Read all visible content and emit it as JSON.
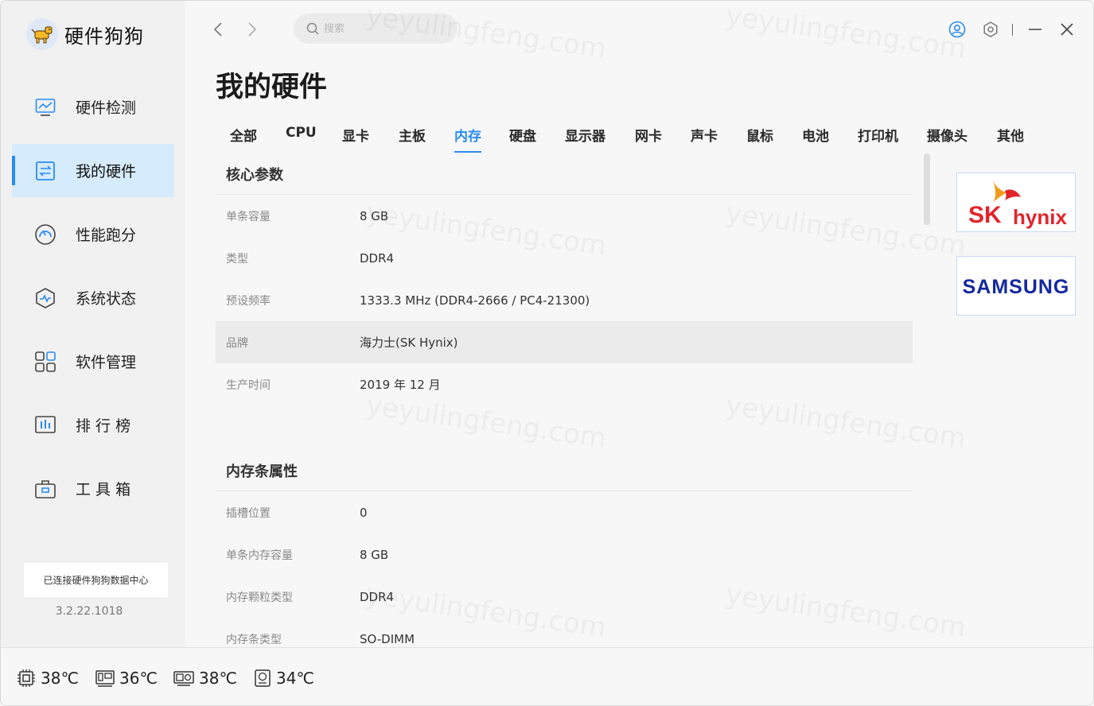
{
  "app": {
    "name": "硬件狗狗",
    "version": "3.2.22.1018",
    "connection_status": "已连接硬件狗狗数据中心"
  },
  "sidebar": {
    "items": [
      {
        "label": "硬件检测",
        "icon": "monitor-chart-icon",
        "active": false
      },
      {
        "label": "我的硬件",
        "icon": "hardware-transfer-icon",
        "active": true
      },
      {
        "label": "性能跑分",
        "icon": "speedometer-icon",
        "active": false
      },
      {
        "label": "系统状态",
        "icon": "system-status-icon",
        "active": false
      },
      {
        "label": "软件管理",
        "icon": "apps-grid-icon",
        "active": false
      },
      {
        "label": "排 行 榜",
        "icon": "ranking-chart-icon",
        "active": false
      },
      {
        "label": "工 具 箱",
        "icon": "toolbox-icon",
        "active": false
      }
    ]
  },
  "header": {
    "search_placeholder": "搜索",
    "page_title": "我的硬件"
  },
  "tabs": [
    "全部",
    "CPU",
    "显卡",
    "主板",
    "内存",
    "硬盘",
    "显示器",
    "网卡",
    "声卡",
    "鼠标",
    "电池",
    "打印机",
    "摄像头",
    "其他"
  ],
  "active_tab": "内存",
  "sections": [
    {
      "title": "核心参数",
      "rows": [
        {
          "key": "单条容量",
          "value": "8 GB"
        },
        {
          "key": "类型",
          "value": "DDR4"
        },
        {
          "key": "预设频率",
          "value": "1333.3 MHz (DDR4-2666 / PC4-21300)"
        },
        {
          "key": "品牌",
          "value": "海力士(SK Hynix)"
        },
        {
          "key": "生产时间",
          "value": "2019 年 12 月"
        }
      ]
    },
    {
      "title": "内存条属性",
      "rows": [
        {
          "key": "插槽位置",
          "value": "0"
        },
        {
          "key": "单条内存容量",
          "value": "8 GB"
        },
        {
          "key": "内存颗粒类型",
          "value": "DDR4"
        },
        {
          "key": "内存条类型",
          "value": "SO-DIMM"
        }
      ]
    }
  ],
  "brand_logos": [
    {
      "name": "SK hynix",
      "sk": "SK",
      "hynix": "hynix"
    },
    {
      "name": "SAMSUNG",
      "text": "SAMSUNG"
    }
  ],
  "temperatures": [
    {
      "label": "cpu",
      "icon": "cpu-chip-icon",
      "value": "38℃"
    },
    {
      "label": "motherboard",
      "icon": "motherboard-icon",
      "value": "36℃"
    },
    {
      "label": "gpu",
      "icon": "graphics-card-icon",
      "value": "38℃"
    },
    {
      "label": "disk",
      "icon": "hard-disk-icon",
      "value": "34℃"
    }
  ],
  "watermark": "yeyulingfeng.com",
  "colors": {
    "accent": "#2a8cf0",
    "active_bg": "#d6ebfb",
    "sk_red": "#e2242b",
    "sk_orange": "#f39a1c",
    "samsung_blue": "#1428a0"
  }
}
